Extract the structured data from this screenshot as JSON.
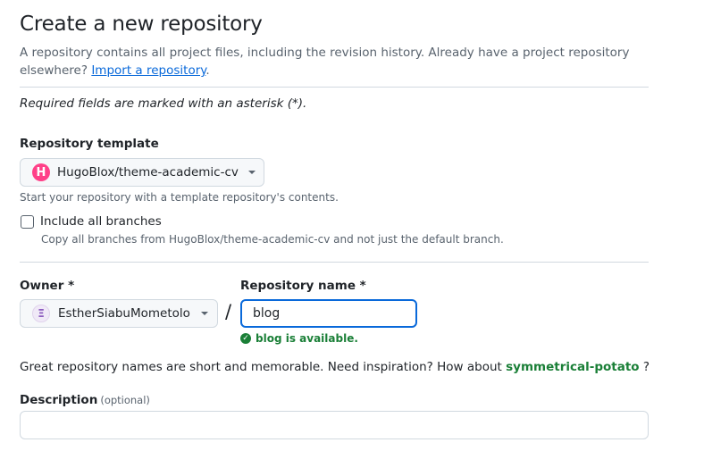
{
  "header": {
    "title": "Create a new repository",
    "intro": "A repository contains all project files, including the revision history. Already have a project repository elsewhere?",
    "import_link": "Import a repository",
    "import_suffix": "."
  },
  "required_note": "Required fields are marked with an asterisk (*).",
  "template": {
    "label": "Repository template",
    "selected": "HugoBlox/theme-academic-cv",
    "icon_letter": "H",
    "hint": "Start your repository with a template repository's contents.",
    "include_branches_label": "Include all branches",
    "include_branches_hint": "Copy all branches from HugoBlox/theme-academic-cv and not just the default branch.",
    "include_branches_checked": false
  },
  "owner": {
    "label": "Owner *",
    "selected": "EstherSiabuMometolo",
    "avatar_glyph": "Ξ"
  },
  "separator": "/",
  "repo_name": {
    "label": "Repository name *",
    "value": "blog",
    "availability": "blog is available."
  },
  "suggestion": {
    "prefix": "Great repository names are short and memorable. Need inspiration? How about",
    "name": "symmetrical-potato",
    "suffix": " ?"
  },
  "description": {
    "label": "Description",
    "optional": "(optional)",
    "value": ""
  },
  "colors": {
    "accent": "#0969da",
    "success": "#1a7f37",
    "template_icon": "#ff4088"
  }
}
